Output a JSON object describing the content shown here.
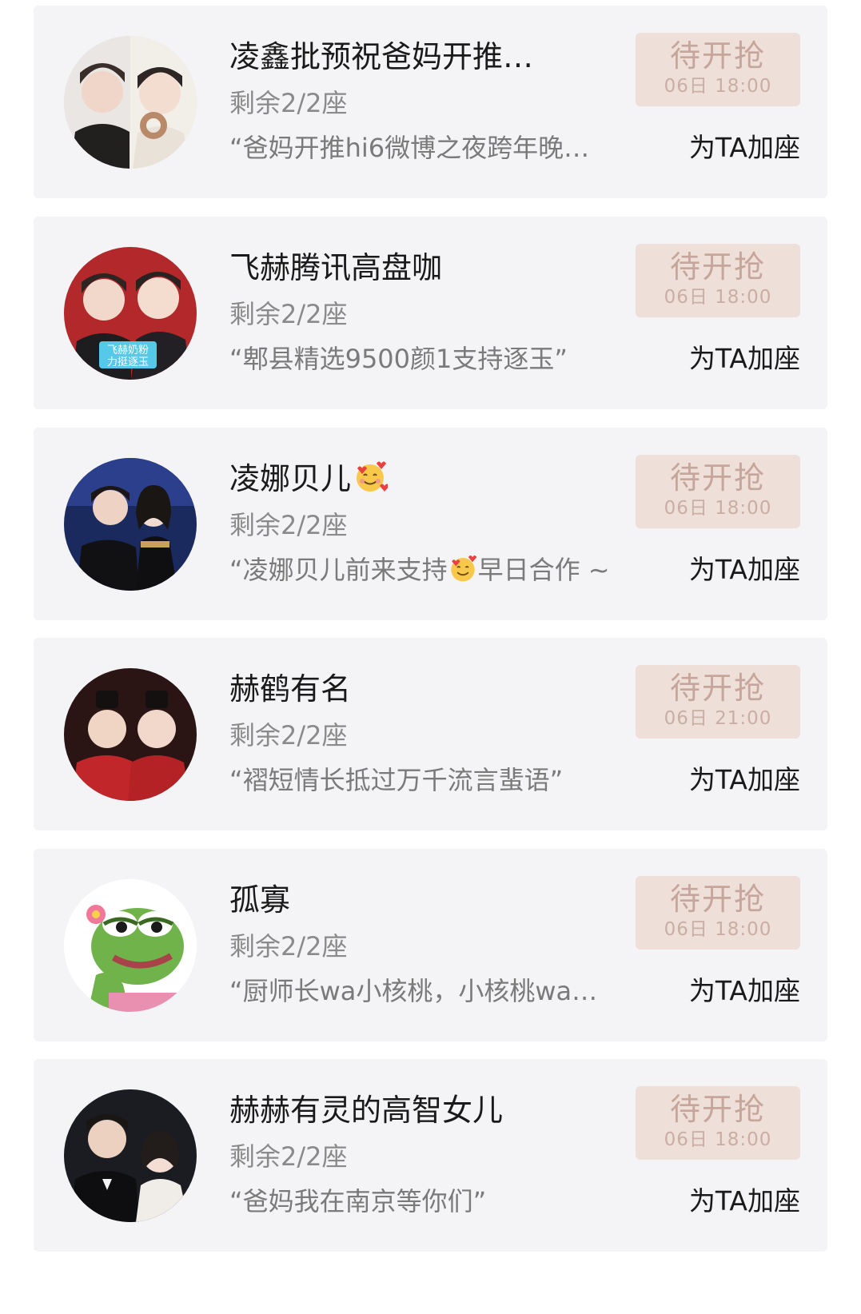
{
  "colors": {
    "card_bg": "#f4f4f6",
    "button_bg": "#efdfd9",
    "button_text": "#c6a69b"
  },
  "rows": [
    {
      "name": "凌鑫批预祝爸妈开推…",
      "seats": "剩余2/2座",
      "message": "“爸妈开推hi6微博之夜跨年晚…",
      "status": "待开抢",
      "time": "06日 18:00",
      "action": "为TA加座",
      "avatar_icon": "avatar-photo-two-men"
    },
    {
      "name": "飞赫腾讯高盘咖",
      "seats": "剩余2/2座",
      "message": "“郫县精选9500颜1支持逐玉”",
      "status": "待开抢",
      "time": "06日 18:00",
      "action": "为TA加座",
      "avatar_icon": "avatar-photo-two-men-red"
    },
    {
      "name": "凌娜贝儿",
      "seats": "剩余2/2座",
      "message_parts": [
        "“凌娜贝儿前来支持",
        "早日合作 ~"
      ],
      "status": "待开抢",
      "time": "06日 18:00",
      "action": "为TA加座",
      "avatar_icon": "avatar-photo-couple-event",
      "name_emoji": "smiling-face-with-hearts-icon"
    },
    {
      "name": "赫鹤有名",
      "seats": "剩余2/2座",
      "message": "“褶短情长抵过万千流言蜚语”",
      "status": "待开抢",
      "time": "06日 21:00",
      "action": "为TA加座",
      "avatar_icon": "avatar-photo-two-men-costume"
    },
    {
      "name": "孤寡",
      "seats": "剩余2/2座",
      "message": "“厨师长wa小核桃，小核桃wa…",
      "status": "待开抢",
      "time": "06日 18:00",
      "action": "为TA加座",
      "avatar_icon": "avatar-frog-cartoon"
    },
    {
      "name": "赫赫有灵的高智女儿",
      "seats": "剩余2/2座",
      "message": "“爸妈我在南京等你们”",
      "status": "待开抢",
      "time": "06日 18:00",
      "action": "为TA加座",
      "avatar_icon": "avatar-photo-couple-formal"
    }
  ]
}
